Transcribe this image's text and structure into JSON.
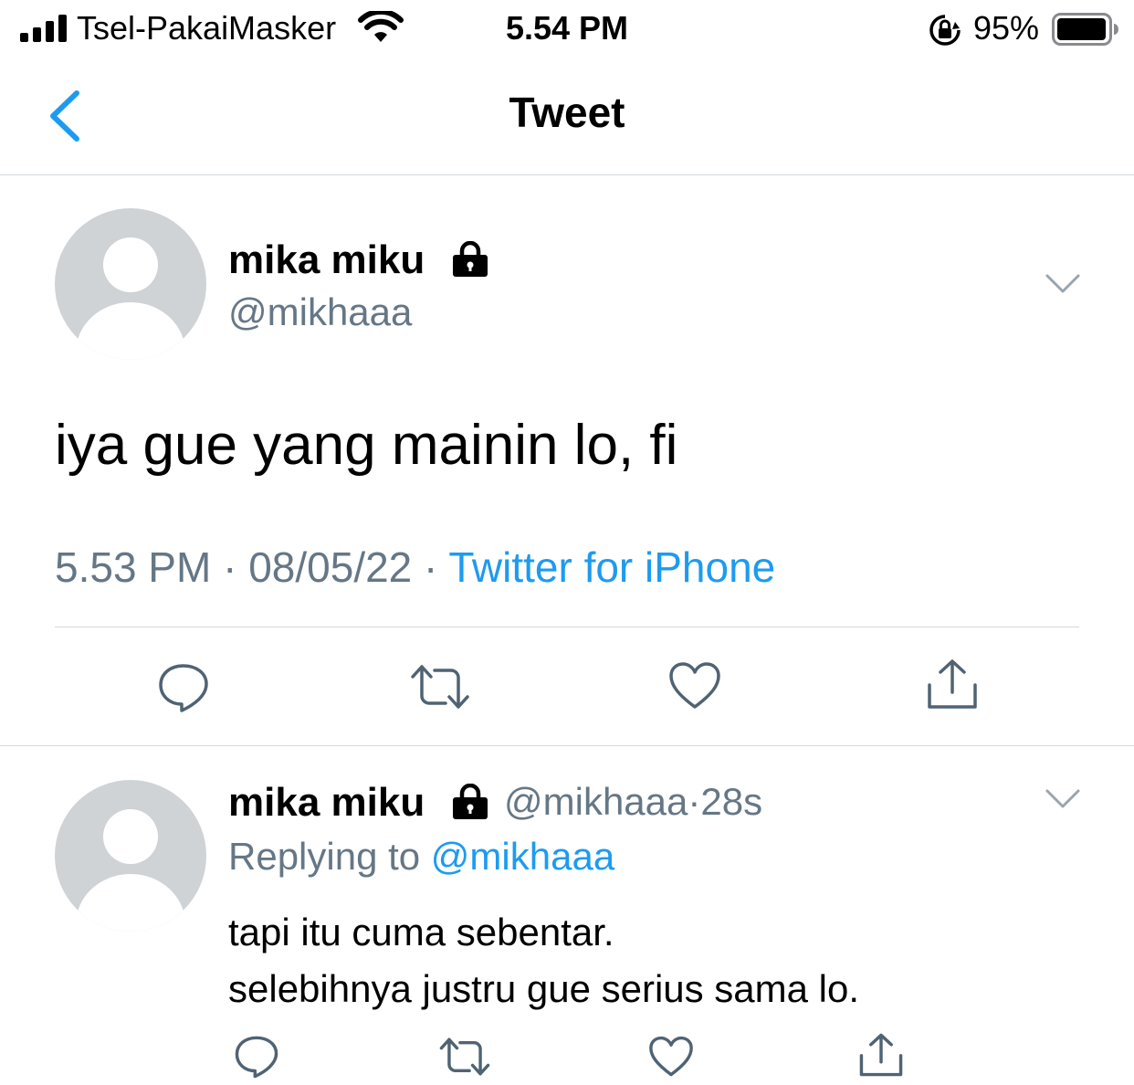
{
  "status_bar": {
    "carrier": "Tsel-PakaiMasker",
    "time": "5.54 PM",
    "battery_percent": "95%",
    "signal_icon": "signal-bars-icon",
    "wifi_icon": "wifi-icon",
    "rotation_lock_icon": "rotation-lock-icon",
    "battery_icon": "battery-icon"
  },
  "nav": {
    "title": "Tweet",
    "back_icon": "chevron-left-icon",
    "accent": "#1d9bf0"
  },
  "tweet": {
    "display_name": "mika miku",
    "handle": "@mikhaaa",
    "protected_icon": "lock-icon",
    "text": "iya gue yang mainin lo, fi",
    "time": "5.53 PM",
    "sep1": " · ",
    "date": "08/05/22",
    "sep2": " · ",
    "source": "Twitter for iPhone",
    "actions": [
      "reply-icon",
      "retweet-icon",
      "like-icon",
      "share-icon"
    ]
  },
  "reply": {
    "display_name": "mika miku",
    "handle": "@mikhaaa",
    "dot": "·",
    "age": "28s",
    "replying_prefix": "Replying to ",
    "replying_to": "@mikhaaa",
    "text_lines": [
      "tapi itu cuma sebentar.",
      "selebihnya justru gue serius sama lo."
    ],
    "actions": [
      "reply-icon",
      "retweet-icon",
      "like-icon",
      "share-icon"
    ]
  },
  "colors": {
    "accent": "#1d9bf0",
    "secondary_text": "#657786",
    "divider": "#d4d9dd"
  }
}
